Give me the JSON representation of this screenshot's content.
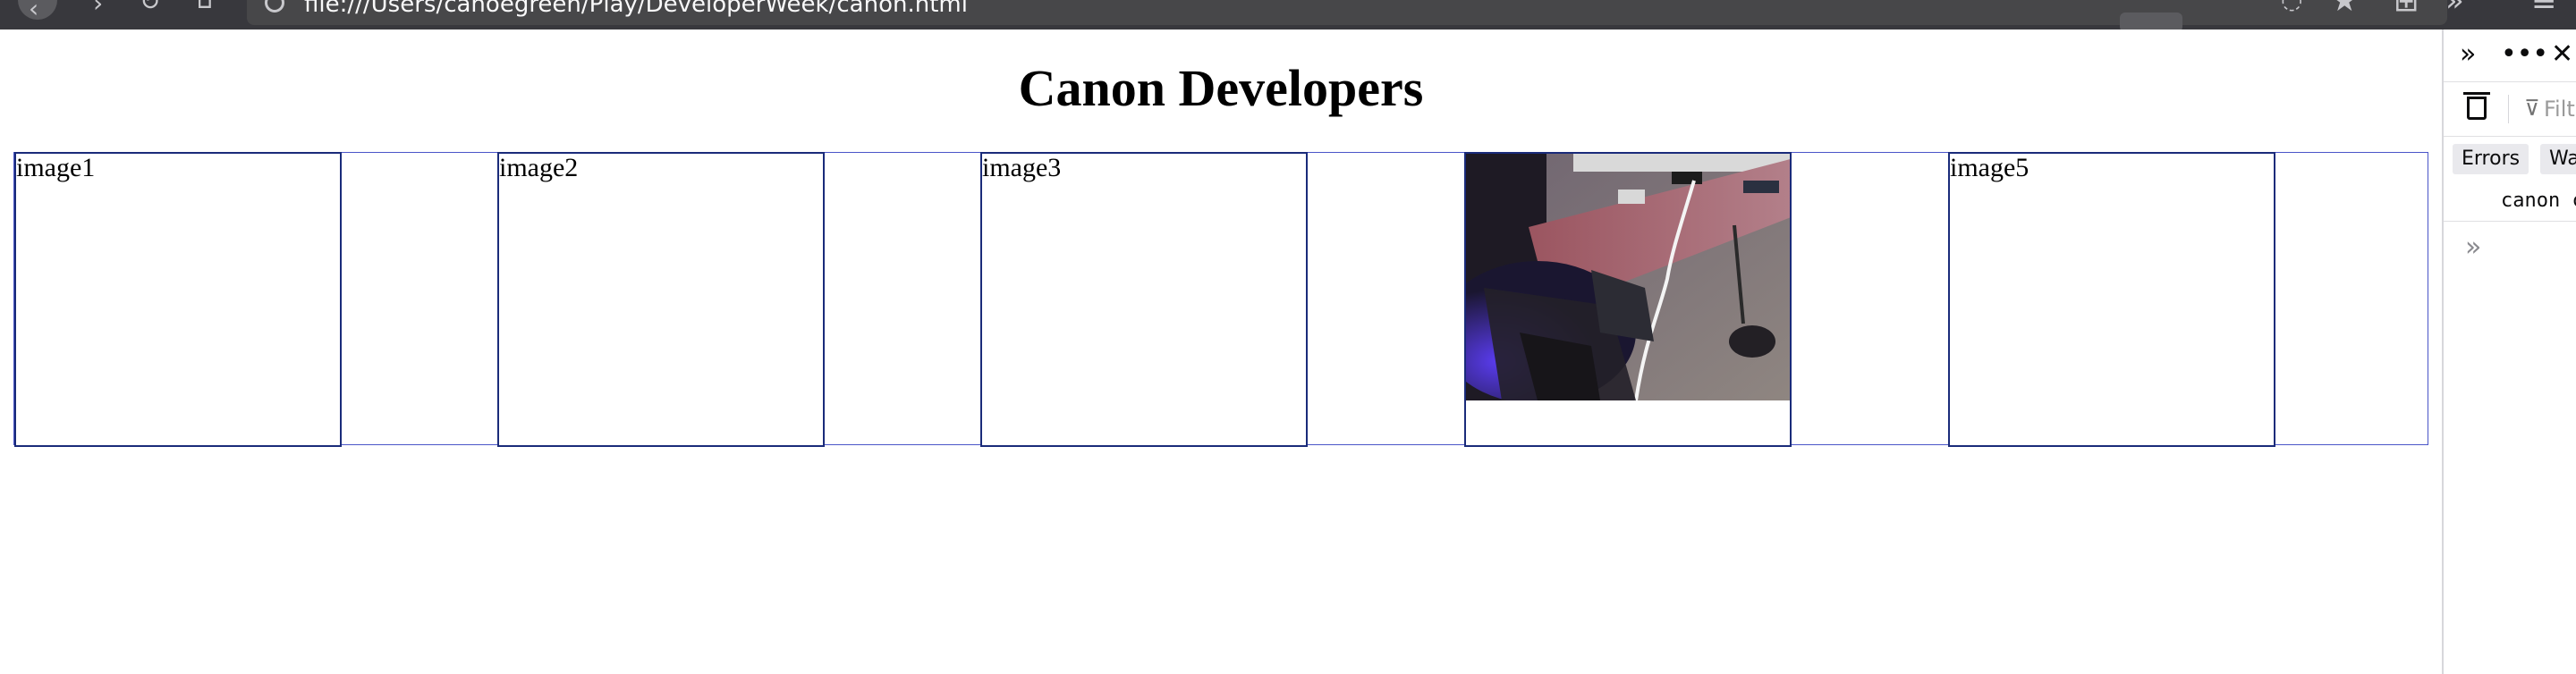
{
  "browser": {
    "url": "file:///Users/canoegreen/Play/DeveloperWeek/canon.html",
    "icons": [
      "back-icon",
      "forward-icon",
      "reload-icon",
      "home-icon",
      "info-icon",
      "star-icon",
      "extensions-icon",
      "menu-icon"
    ]
  },
  "page": {
    "title": "Canon Developers",
    "tiles": [
      {
        "label": "image1",
        "has_image": false
      },
      {
        "label": "image2",
        "has_image": false
      },
      {
        "label": "image3",
        "has_image": false
      },
      {
        "label": "",
        "has_image": true
      },
      {
        "label": "image5",
        "has_image": false
      }
    ]
  },
  "devtools": {
    "filter_placeholder": "Filt",
    "tabs": [
      "Errors",
      "War"
    ],
    "log_text": "canon c",
    "icons": [
      "expand-icon",
      "more-icon",
      "close-icon",
      "trash-icon",
      "filter-icon",
      "prompt-icon"
    ]
  },
  "colors": {
    "chrome_bg": "#38383d",
    "gallery_border": "#4a55c8",
    "tile_border": "#1a2b7a"
  }
}
